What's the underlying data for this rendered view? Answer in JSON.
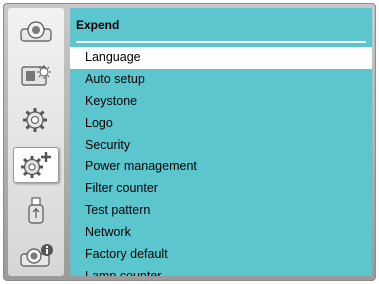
{
  "sidebar": {
    "items": [
      {
        "icon": "projector-display-icon",
        "active": false
      },
      {
        "icon": "picture-adjust-icon",
        "active": false
      },
      {
        "icon": "settings-gear-icon",
        "active": false
      },
      {
        "icon": "expand-gear-plus-icon",
        "active": true
      },
      {
        "icon": "usb-memory-icon",
        "active": false
      },
      {
        "icon": "projector-info-icon",
        "active": false
      }
    ]
  },
  "panel": {
    "title": "Expend",
    "items": [
      {
        "label": "Language",
        "selected": true
      },
      {
        "label": "Auto setup",
        "selected": false
      },
      {
        "label": "Keystone",
        "selected": false
      },
      {
        "label": "Logo",
        "selected": false
      },
      {
        "label": "Security",
        "selected": false
      },
      {
        "label": "Power management",
        "selected": false
      },
      {
        "label": "Filter counter",
        "selected": false
      },
      {
        "label": "Test pattern",
        "selected": false
      },
      {
        "label": "Network",
        "selected": false
      },
      {
        "label": "Factory default",
        "selected": false
      },
      {
        "label": "Lamp counter",
        "selected": false
      }
    ]
  },
  "colors": {
    "panel_bg": "#5cc6cf",
    "selected_bg": "#ffffff",
    "sidebar_bg": "#e6e6e6"
  }
}
